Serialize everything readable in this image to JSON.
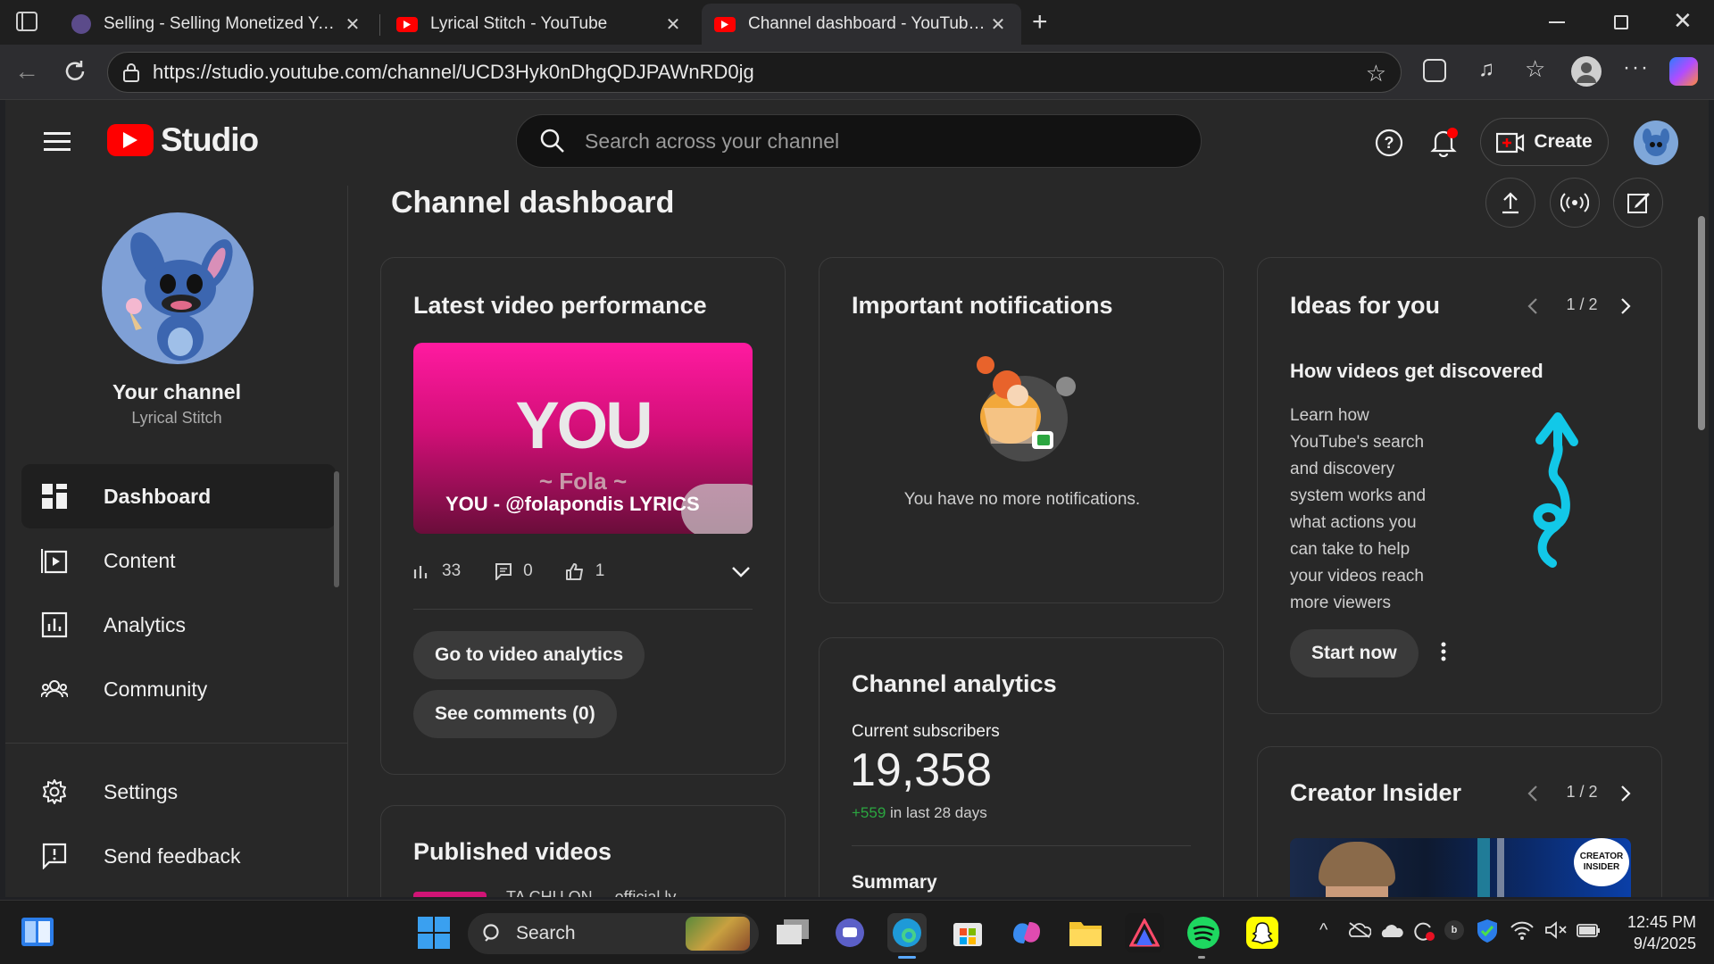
{
  "browser": {
    "tabs": [
      {
        "title": "Selling - Selling Monetized YouTu",
        "active": false
      },
      {
        "title": "Lyrical Stitch - YouTube",
        "active": false
      },
      {
        "title": "Channel dashboard - YouTube Stu",
        "active": true
      }
    ],
    "url": "https://studio.youtube.com/channel/UCD3Hyk0nDhgQDJPAWnRD0jg"
  },
  "header": {
    "logo_text": "Studio",
    "search_placeholder": "Search across your channel",
    "create_label": "Create"
  },
  "sidebar": {
    "channel_title": "Your channel",
    "channel_name": "Lyrical Stitch",
    "items": [
      {
        "label": "Dashboard",
        "icon": "dashboard-icon",
        "active": true
      },
      {
        "label": "Content",
        "icon": "content-icon"
      },
      {
        "label": "Analytics",
        "icon": "analytics-icon"
      },
      {
        "label": "Community",
        "icon": "community-icon"
      }
    ],
    "bottom_items": [
      {
        "label": "Settings",
        "icon": "gear-icon"
      },
      {
        "label": "Send feedback",
        "icon": "feedback-icon"
      }
    ]
  },
  "page": {
    "title": "Channel dashboard"
  },
  "latest_video": {
    "heading": "Latest video performance",
    "thumb_big_text": "YOU",
    "thumb_small_text": "~ Fola ~",
    "video_title": "YOU - @folapondis LYRICS",
    "views": "33",
    "comments": "0",
    "likes": "1",
    "analytics_button": "Go to video analytics",
    "comments_button": "See comments (0)"
  },
  "published": {
    "heading": "Published videos",
    "first_item": "TA CHU ON   ... official ly"
  },
  "notifications": {
    "heading": "Important notifications",
    "empty_text": "You have no more notifications."
  },
  "channel_analytics": {
    "heading": "Channel analytics",
    "subscribers_label": "Current subscribers",
    "subscribers": "19,358",
    "change": "+559",
    "change_suffix": "in last 28 days",
    "summary_label": "Summary"
  },
  "ideas": {
    "heading": "Ideas for you",
    "pager": "1 / 2",
    "title": "How videos get discovered",
    "body": "Learn how YouTube's search and discovery system works and what actions you can take to help your videos reach more viewers",
    "cta": "Start now"
  },
  "creator_insider": {
    "heading": "Creator Insider",
    "pager": "1 / 2",
    "badge_line1": "CREATOR",
    "badge_line2": "INSIDER"
  },
  "taskbar": {
    "search_label": "Search",
    "time": "12:45 PM",
    "date": "9/4/2025"
  },
  "colors": {
    "youtube_red": "#ff0000",
    "positive_green": "#2ba640",
    "thumb_pink": "#e0127f"
  }
}
